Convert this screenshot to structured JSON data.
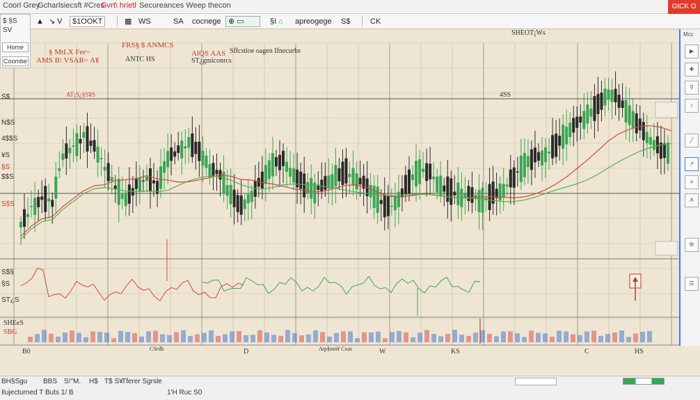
{
  "window": {
    "title_left": "Coorl Grey",
    "title_app": "Gcharlsiecsft #Cres",
    "title_red": "Gvrt\\ hrietl",
    "title_right": "Secureances Weep thecon",
    "close_label": "GtCK O"
  },
  "toolbar": {
    "symbol": "$1OOKT",
    "tool_a": "WS",
    "tool_b": "SA",
    "tool_c": "cocnege",
    "tool_d": "apreogege",
    "tool_e": "S$",
    "tool_f": "CK",
    "tool_g": "§I"
  },
  "left_panel": {
    "label_a": "$ §S",
    "label_b": "SV",
    "button_home": "Home",
    "button_config": "Coombe"
  },
  "chart_header": {
    "sub_label": "SHEOT¡Ws",
    "legend_red_a": "§ MtLX Fer~",
    "legend_red_b": "FRS§ $ ANMCS",
    "legend_red_c": "AlQS AAS",
    "legend_dark_a": "Sffcstioe oagen Ifnecurbs",
    "legend_dark_b": "ANTC HS",
    "legend_dark_c": "ST¿gmiconrcs",
    "legend_row2": "AMS B\\ VSAR~ A¥",
    "midline_label": "AT¡S¿§S¥S",
    "midline_tag": "4SS"
  },
  "y_axis": {
    "labels": [
      "S$",
      "N$S",
      "4$$S",
      "¥S",
      "§S",
      "$$S",
      "S§S"
    ],
    "osc_labels": [
      "S$§",
      "§S",
      "ST¿S"
    ]
  },
  "volume_panel": {
    "title": "SHEeS",
    "sub": "SBG",
    "x_labels": [
      "B0",
      "CSrdb",
      "D",
      "Atp§mn¥ Cxas",
      "W",
      "KS",
      "C",
      "HS"
    ]
  },
  "status_bar": {
    "left_a": "BH§Sgu",
    "left_b": "BBS",
    "left_c": "S!\"M.",
    "left_d": "H$",
    "left_e": "T$ S¥",
    "left_f": "Tferer Sgrsle",
    "bottom_a": "Ilujecturned T Buts 1/ B",
    "bottom_b": "1'H  Ruc  S0"
  },
  "right_panel": {
    "header": "Mcc",
    "icons": [
      "select-icon",
      "crosshair-icon",
      "zoom-icon",
      "measure-icon",
      "line-icon",
      "trend-icon",
      "fib-icon",
      "text-icon"
    ]
  },
  "chart_data": {
    "type": "line",
    "title": "",
    "xlabel": "",
    "ylabel": "",
    "series": [
      {
        "name": "",
        "color": "#2e9e4a",
        "values": [
          31,
          38,
          42,
          40,
          55,
          58,
          63,
          60,
          52,
          44,
          40,
          46,
          49,
          45,
          54,
          57,
          61,
          58,
          51,
          48,
          42,
          39,
          43,
          47,
          52,
          54,
          50,
          46,
          43,
          45,
          49,
          51,
          48,
          44,
          40,
          38,
          42,
          47,
          50,
          49,
          46,
          44,
          42,
          41,
          40,
          43,
          45,
          48,
          52,
          55,
          57,
          60,
          63,
          66,
          70,
          74,
          78,
          74,
          69,
          66,
          62,
          58,
          55
        ]
      }
    ],
    "colors": {
      "up_candle": "#3aa655",
      "down_candle": "#2a2a2a",
      "ma_red": "#d14a3a",
      "ma_green": "#52b04e",
      "volume_blue": "#4a7ccc",
      "volume_red": "#d9534f",
      "grid": "#c9bfae"
    },
    "grid": true,
    "legend": "top-left"
  }
}
